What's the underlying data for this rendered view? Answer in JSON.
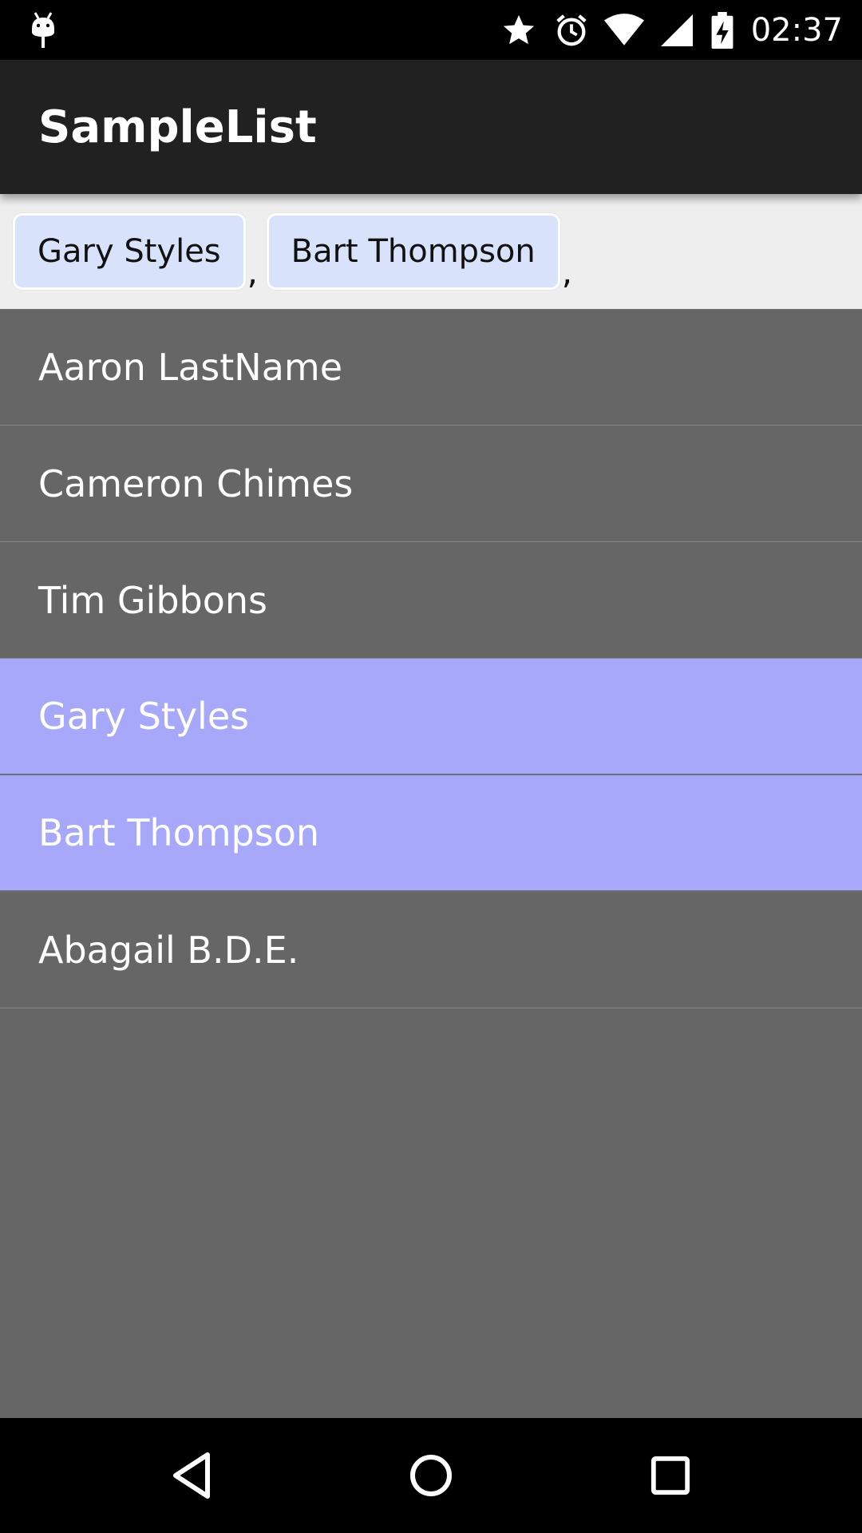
{
  "status_bar": {
    "time": "02:37",
    "icons": [
      "android-debug-icon",
      "star-icon",
      "alarm-icon",
      "wifi-icon",
      "cell-signal-icon",
      "battery-charging-icon"
    ]
  },
  "action_bar": {
    "title": "SampleList"
  },
  "chips": {
    "items": [
      {
        "label": "Gary Styles",
        "separator": ","
      },
      {
        "label": "Bart Thompson",
        "separator": ","
      }
    ]
  },
  "list": {
    "items": [
      {
        "label": "Aaron LastName",
        "selected": false
      },
      {
        "label": "Cameron Chimes",
        "selected": false
      },
      {
        "label": "Tim Gibbons",
        "selected": false
      },
      {
        "label": "Gary Styles",
        "selected": true
      },
      {
        "label": "Bart Thompson",
        "selected": true
      },
      {
        "label": "Abagail B.D.E.",
        "selected": false
      }
    ]
  },
  "nav_bar": {
    "buttons": [
      "back-icon",
      "home-icon",
      "recents-icon"
    ]
  },
  "colors": {
    "status_bar": "#000000",
    "action_bar": "#212121",
    "chip_area": "#eeeeee",
    "chip_fill": "#d9e2fb",
    "list_background": "#666666",
    "selected_row": "#a8a8fa",
    "nav_bar": "#000000"
  }
}
